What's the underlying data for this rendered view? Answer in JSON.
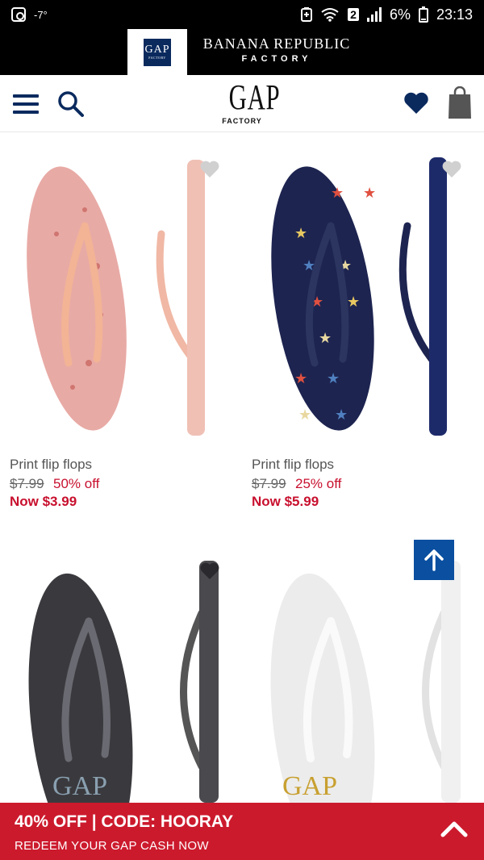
{
  "status_bar": {
    "left_icons": [
      "instagram-icon",
      "weather-icon"
    ],
    "temperature": "-7°",
    "network_badge": "2",
    "battery": "6%",
    "time": "23:13"
  },
  "brand_tabs": {
    "gap_logo_text": "GAP",
    "gap_logo_sub": "FACTORY",
    "banana_line1": "BANANA REPUBLIC",
    "banana_line2": "FACTORY"
  },
  "header": {
    "logo_text": "GAP",
    "logo_sub": "FACTORY"
  },
  "products": [
    {
      "name": "Print flip flops",
      "original_price": "$7.99",
      "discount": "50% off",
      "now_price": "Now $3.99"
    },
    {
      "name": "Print flip flops",
      "original_price": "$7.99",
      "discount": "25% off",
      "now_price": "Now $5.99"
    },
    {
      "name": "",
      "original_price": "",
      "discount": "",
      "now_price": ""
    },
    {
      "name": "",
      "original_price": "",
      "discount": "",
      "now_price": ""
    }
  ],
  "promo": {
    "headline": "40% OFF | CODE: HOORAY",
    "subline": "REDEEM YOUR GAP CASH NOW"
  },
  "colors": {
    "navy": "#0a2a5e",
    "sale_red": "#c8102e",
    "promo_red": "#cc1a2d",
    "back_to_top": "#0a4fa0"
  }
}
